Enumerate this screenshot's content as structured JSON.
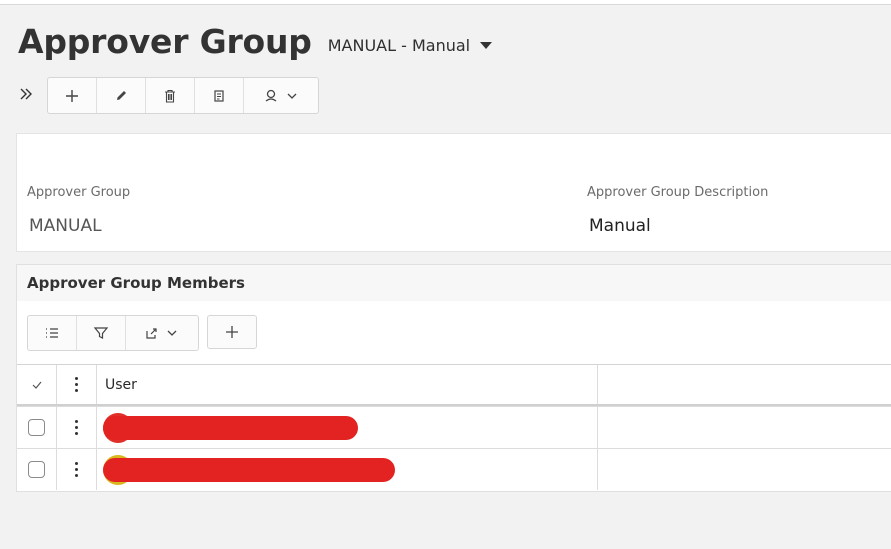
{
  "header": {
    "title": "Approver Group",
    "record_selector": "MANUAL - Manual"
  },
  "toolbar": {
    "buttons": [
      "plus-icon",
      "pencil-icon",
      "trash-icon",
      "copy-icon",
      "approver-dropdown-icon"
    ]
  },
  "form": {
    "approver_group_label": "Approver Group",
    "approver_group_value": "MANUAL",
    "description_label": "Approver Group Description",
    "description_value": "Manual"
  },
  "members": {
    "title": "Approver Group Members",
    "toolbar_icons": [
      "list-icon",
      "filter-icon",
      "export-icon",
      "plus-icon"
    ],
    "columns": {
      "user": "User"
    },
    "rows": [
      {
        "user": "",
        "redacted": true
      },
      {
        "user": "",
        "redacted": true
      }
    ]
  },
  "colors": {
    "redaction": "#e32222",
    "avatar_a": "#e0302a",
    "avatar_b": "#d9b81e",
    "background": "#f2f2f2"
  }
}
